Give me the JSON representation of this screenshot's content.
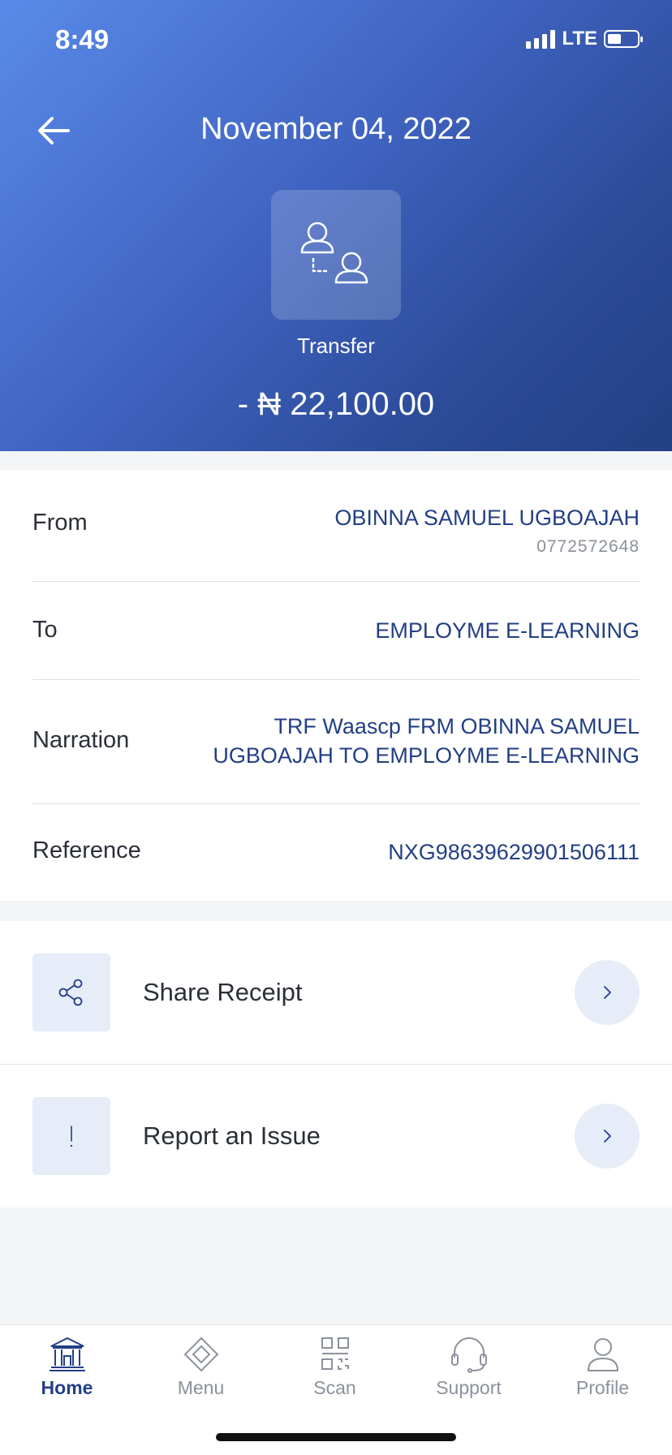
{
  "status_bar": {
    "time": "8:49",
    "network": "LTE",
    "battery_level": 0.4
  },
  "header": {
    "title": "November 04, 2022",
    "type_icon": "person-transfer-icon",
    "type_label": "Transfer",
    "amount": "- ₦ 22,100.00"
  },
  "details": {
    "from": {
      "label": "From",
      "name": "OBINNA SAMUEL UGBOAJAH",
      "account": "0772572648"
    },
    "to": {
      "label": "To",
      "value": "EMPLOYME E-LEARNING"
    },
    "narration": {
      "label": "Narration",
      "line1": "TRF Waascp FRM OBINNA SAMUEL",
      "line2": "UGBOAJAH TO EMPLOYME E-LEARNING"
    },
    "reference": {
      "label": "Reference",
      "value": "NXG98639629901506111"
    }
  },
  "actions": [
    {
      "label": "Share Receipt",
      "icon": "share-icon"
    },
    {
      "label": "Report an Issue",
      "icon": "exclamation-icon"
    }
  ],
  "tabbar": {
    "active": "Home",
    "items": [
      {
        "label": "Home",
        "icon": "bank-icon"
      },
      {
        "label": "Menu",
        "icon": "menu-diamond-icon"
      },
      {
        "label": "Scan",
        "icon": "qr-code-icon"
      },
      {
        "label": "Support",
        "icon": "headset-icon"
      },
      {
        "label": "Profile",
        "icon": "person-icon"
      }
    ]
  },
  "colors": {
    "accent": "#233f85",
    "header_start": "#5a8ae9",
    "header_end": "#233f85",
    "tile_bg": "#e6edf9"
  }
}
